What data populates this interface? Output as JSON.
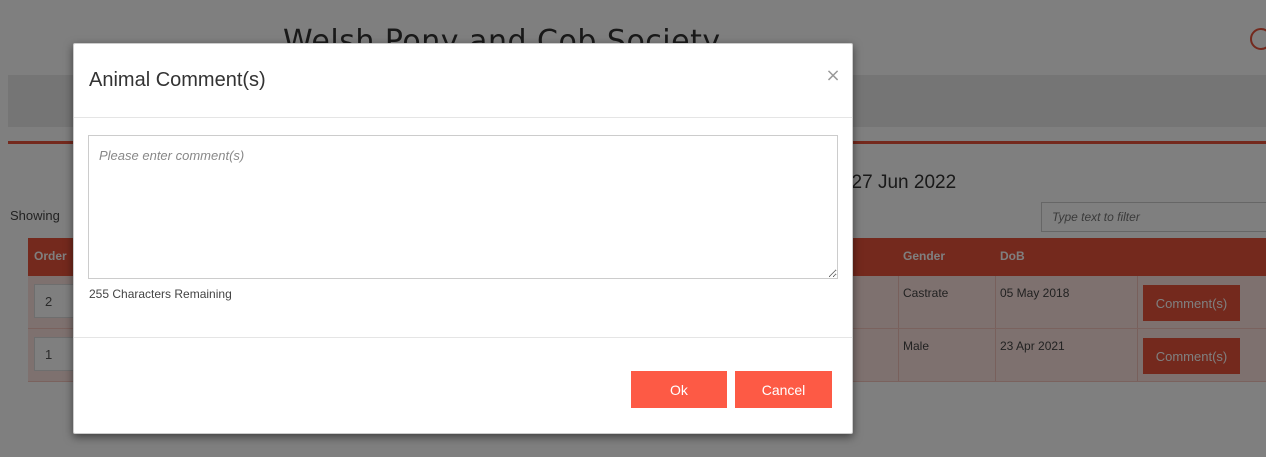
{
  "header": {
    "title": "Welsh Pony and Cob Society"
  },
  "page": {
    "date_text": ": 27 Jun 2022",
    "showing_text": "Showing",
    "filter_placeholder": "Type text to filter"
  },
  "table": {
    "columns": [
      "Order",
      "Gender",
      "DoB"
    ],
    "rows": [
      {
        "order": "2",
        "gender": "Castrate",
        "dob": "05 May 2018",
        "action": "Comment(s)"
      },
      {
        "order": "1",
        "gender": "Male",
        "dob": "23 Apr 2021",
        "action": "Comment(s)"
      }
    ]
  },
  "modal": {
    "title": "Animal Comment(s)",
    "close_icon": "close-icon",
    "close_glyph": "×",
    "comment_placeholder": "Please enter comment(s)",
    "comment_value": "",
    "chars_remaining": "255 Characters Remaining",
    "ok_label": "Ok",
    "cancel_label": "Cancel"
  },
  "colors": {
    "accent": "#e8523a",
    "button": "#fd5a45",
    "row_bg": "#fde3df"
  }
}
